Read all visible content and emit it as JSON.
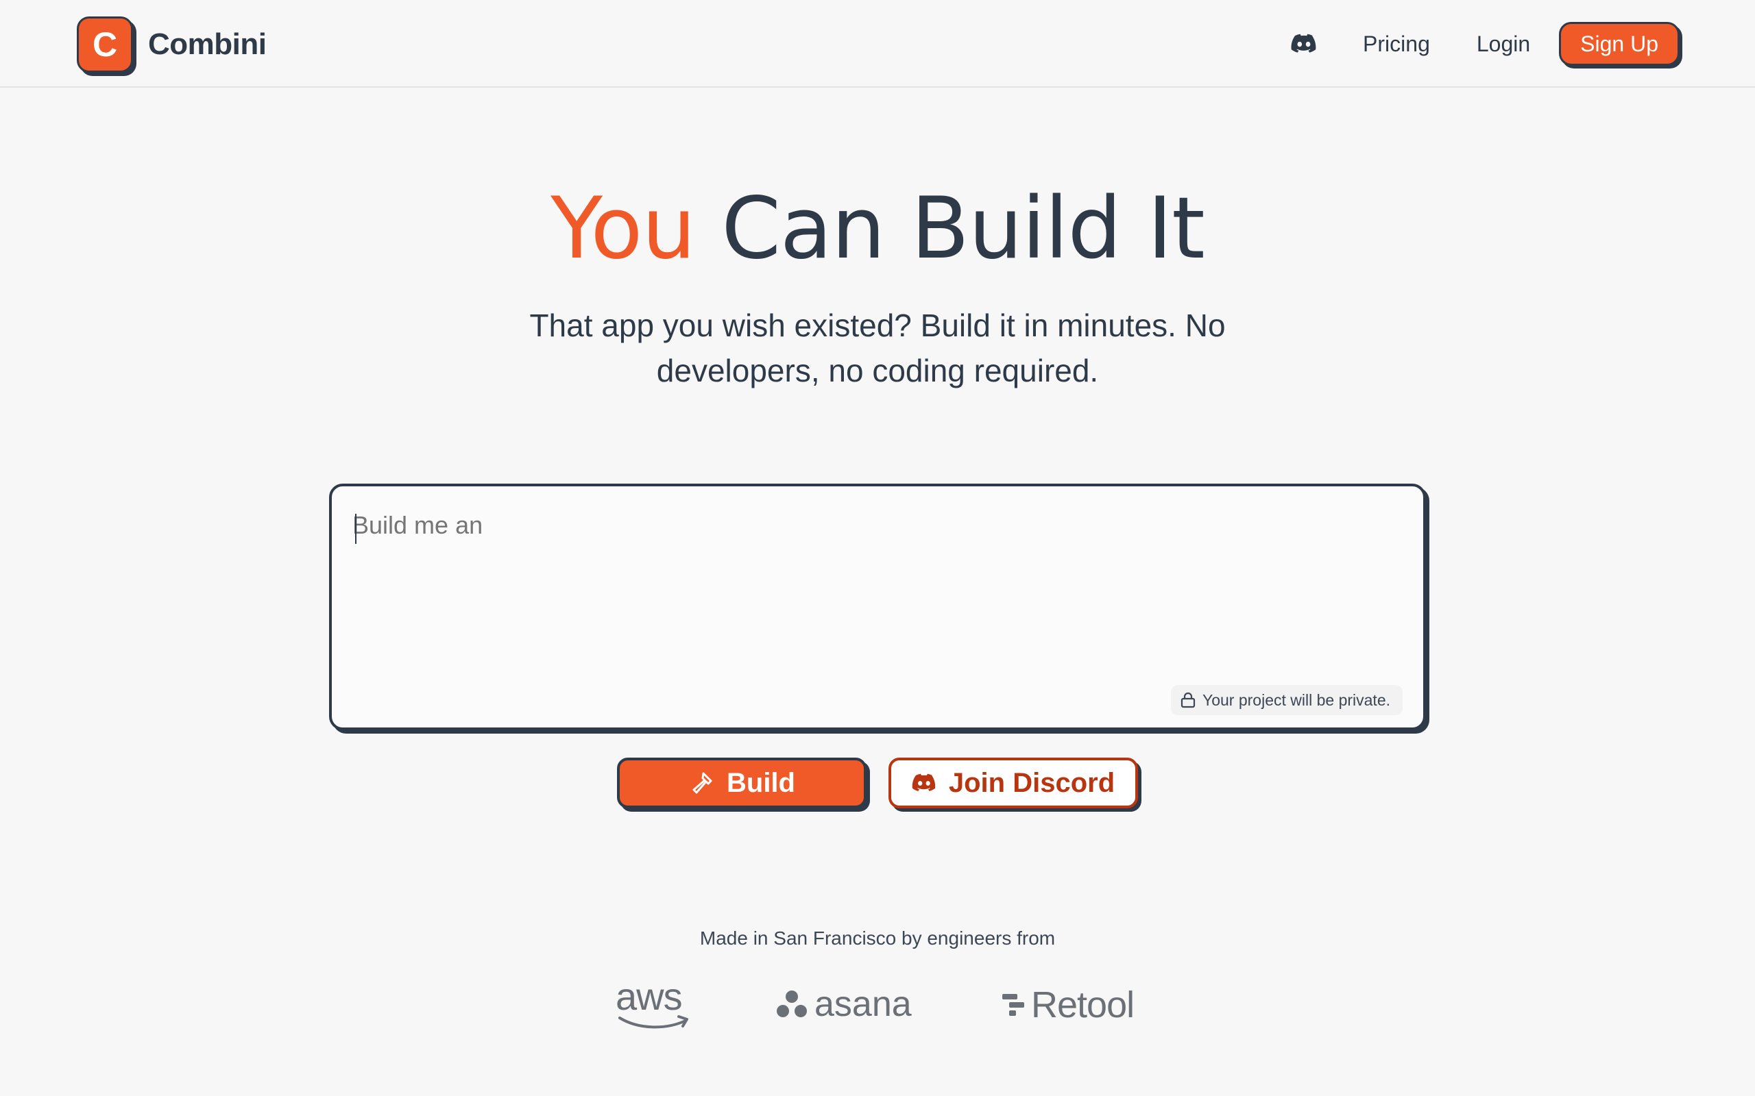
{
  "header": {
    "logo_letter": "C",
    "brand": "Combini",
    "nav": {
      "discord_icon": "discord-icon",
      "pricing": "Pricing",
      "login": "Login",
      "signup": "Sign Up"
    }
  },
  "hero": {
    "title_accent": "You",
    "title_rest": "Can Build It",
    "subtitle": "That app you wish existed? Build it in minutes. No developers, no coding required."
  },
  "prompt": {
    "placeholder": "Build me an",
    "private_note": "Your project will be private."
  },
  "actions": {
    "build": "Build",
    "join_discord": "Join Discord"
  },
  "footer": {
    "made_in": "Made in San Francisco by engineers from",
    "companies": [
      "aws",
      "asana",
      "Retool"
    ]
  },
  "colors": {
    "accent": "#f05a28",
    "ink": "#2f3a48",
    "discord_text": "#b8360f",
    "background": "#f7f7f7"
  }
}
